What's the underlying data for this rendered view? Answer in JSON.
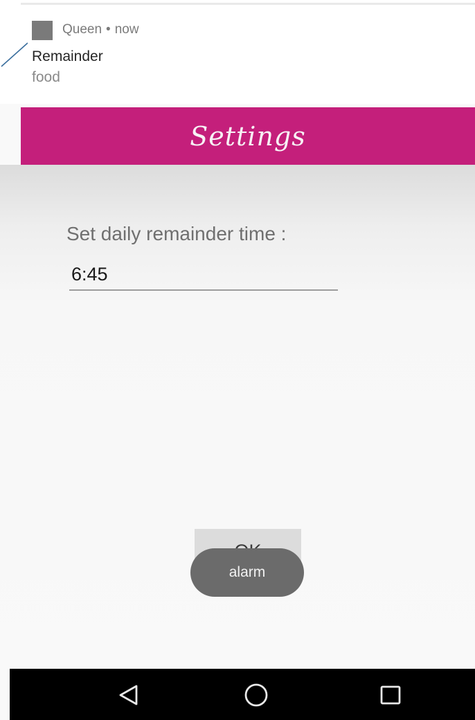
{
  "notification": {
    "app_name": "Queen",
    "separator": "•",
    "time": "now",
    "title": "Remainder",
    "body": "food"
  },
  "header": {
    "title": "Settings",
    "background_color": "#c41f7b"
  },
  "settings": {
    "time_label": "Set daily remainder time :",
    "time_value": "6:45"
  },
  "actions": {
    "ok_label": "OK"
  },
  "toast": {
    "text": "alarm"
  },
  "navbar": {
    "icons": [
      "back-triangle-icon",
      "home-circle-icon",
      "recents-square-icon"
    ]
  }
}
